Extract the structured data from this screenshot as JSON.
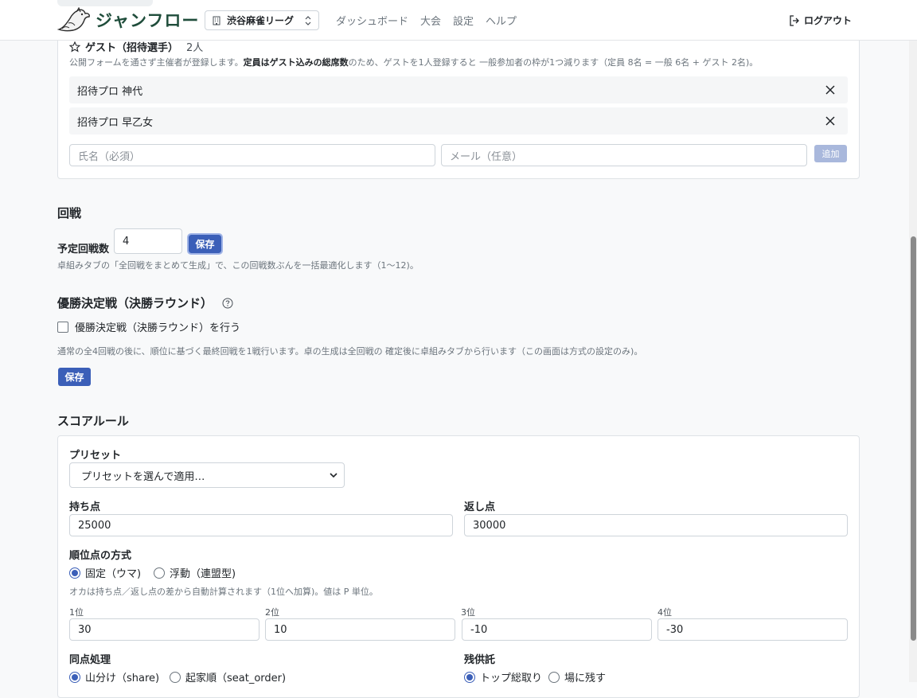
{
  "header": {
    "logo_text": "ジャンフロー",
    "league": "渋谷麻雀リーグ",
    "nav": [
      "ダッシュボード",
      "大会",
      "設定",
      "ヘルプ"
    ],
    "logout": "ログアウト"
  },
  "guests": {
    "title": "ゲスト（招待選手）",
    "count": "2人",
    "desc_1": "公開フォームを通さず主催者が登録します。",
    "desc_bold": "定員はゲスト込みの総席数",
    "desc_2": "のため、ゲストを1人登録すると 一般参加者の枠が1つ減ります（定員 8名 = 一般 6名 + ゲスト 2名)。",
    "list": [
      "招待プロ 神代",
      "招待プロ 早乙女"
    ],
    "name_placeholder": "氏名（必須）",
    "email_placeholder": "メール（任意）",
    "add_label": "追加"
  },
  "rounds": {
    "title": "回戦",
    "label": "予定回戦数",
    "value": "4",
    "save_label": "保存",
    "help": "卓組みタブの「全回戦をまとめて生成」で、この回戦数ぶんを一括最適化します（1〜12)。"
  },
  "final": {
    "title": "優勝決定戦（決勝ラウンド）",
    "checkbox_label": "優勝決定戦（決勝ラウンド）を行う",
    "help": "通常の全4回戦の後に、順位に基づく最終回戦を1戦行います。卓の生成は全回戦の 確定後に卓組みタブから行います（この画面は方式の設定のみ)。",
    "save_label": "保存"
  },
  "score": {
    "title": "スコアルール",
    "preset_label": "プリセット",
    "preset_value": "プリセットを選んで適用…",
    "start_label": "持ち点",
    "start_value": "25000",
    "return_label": "返し点",
    "return_value": "30000",
    "rank_method_label": "順位点の方式",
    "rank_fixed": "固定（ウマ)",
    "rank_float": "浮動（連盟型)",
    "oka_help": "オカは持ち点／返し点の差から自動計算されます（1位へ加算)。値は P 単位。",
    "ranks": [
      {
        "label": "1位",
        "value": "30"
      },
      {
        "label": "2位",
        "value": "10"
      },
      {
        "label": "3位",
        "value": "-10"
      },
      {
        "label": "4位",
        "value": "-30"
      }
    ],
    "tie_label": "同点処理",
    "tie_share": "山分け（share)",
    "tie_seat": "起家順（seat_order)",
    "kyotaku_label": "残供託",
    "kyotaku_top": "トップ総取り",
    "kyotaku_keep": "場に残す"
  }
}
